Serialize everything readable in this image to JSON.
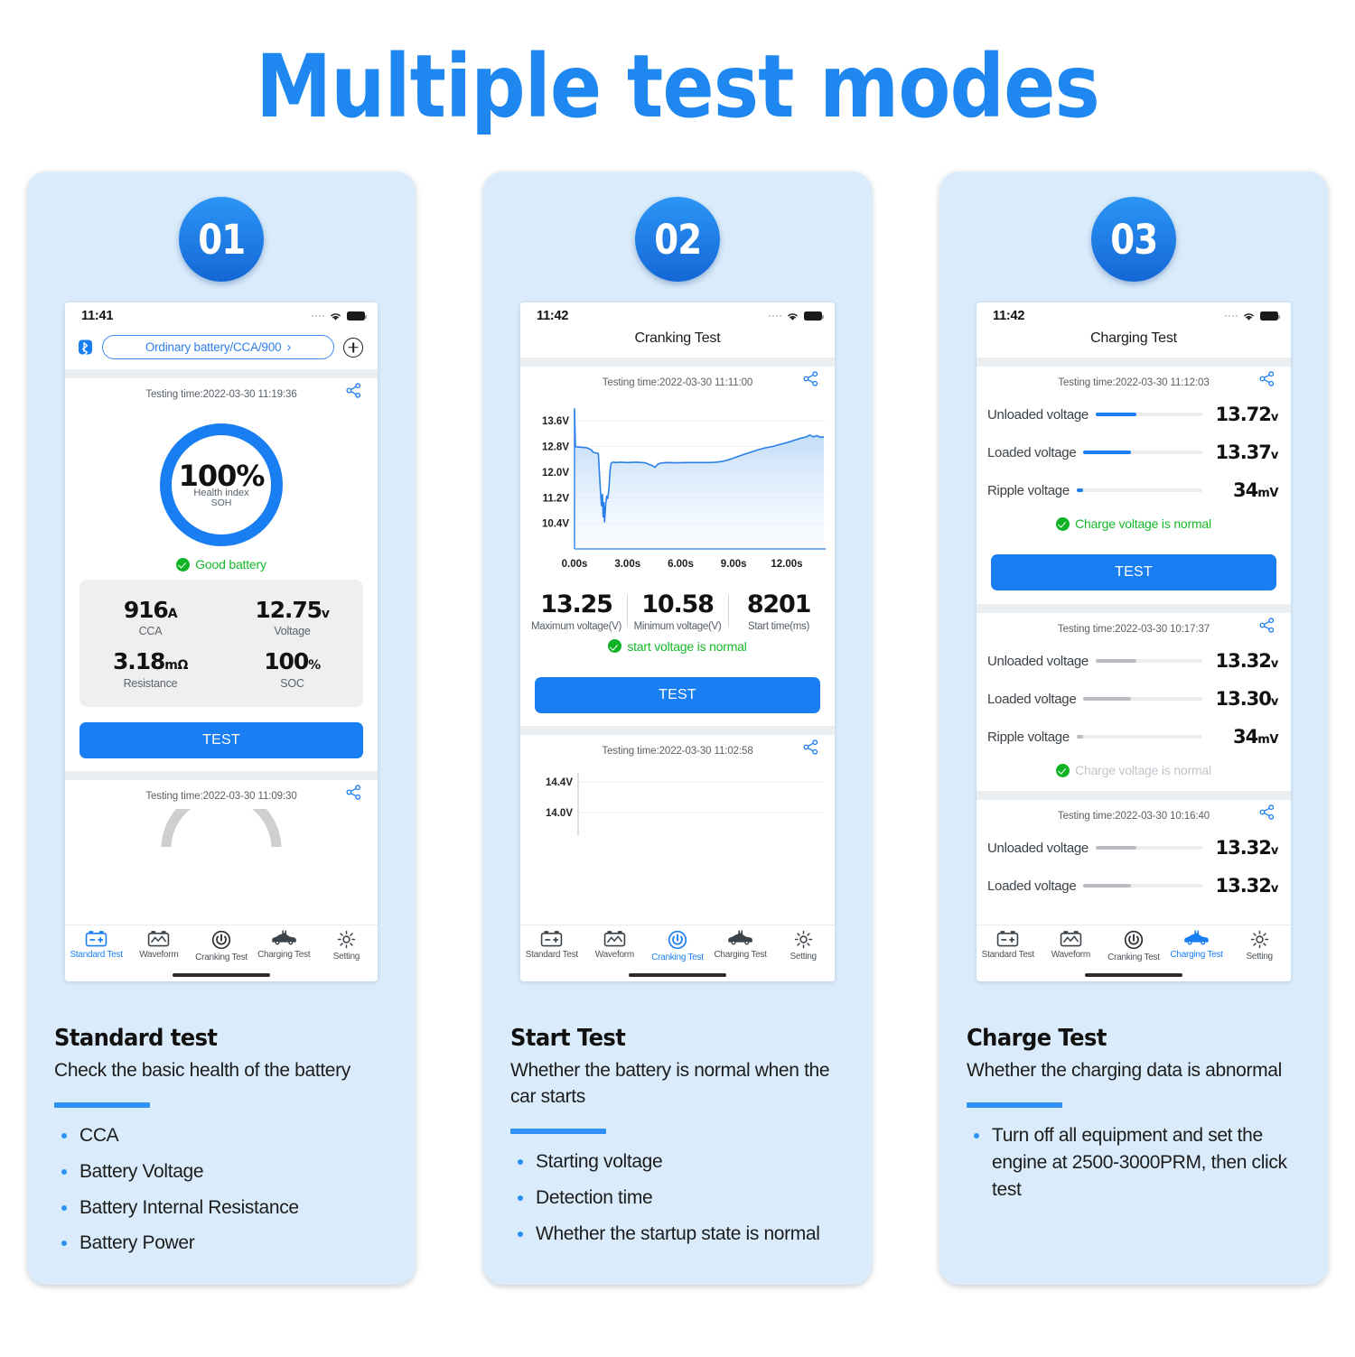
{
  "title": "Multiple test modes",
  "colors": {
    "accent": "#1a7ef3",
    "card_bg": "#daecfb",
    "ok_green": "#14b828",
    "title_blue": "#1e87f0"
  },
  "tabbar": {
    "items": [
      {
        "label": "Standard Test",
        "icon": "battery-terminals-icon"
      },
      {
        "label": "Waveform",
        "icon": "waveform-battery-icon"
      },
      {
        "label": "Cranking Test",
        "icon": "power-button-icon"
      },
      {
        "label": "Charging Test",
        "icon": "car-plug-icon"
      },
      {
        "label": "Setting",
        "icon": "gear-icon"
      }
    ]
  },
  "cards": [
    {
      "badge": "01",
      "caption": {
        "title": "Standard test",
        "subtitle": "Check the basic health of the battery",
        "bullets": [
          "CCA",
          "Battery Voltage",
          "Battery Internal Resistance",
          "Battery Power"
        ]
      },
      "phone": {
        "status": {
          "time": "11:41"
        },
        "selector": {
          "bluetooth": "bluetooth-icon",
          "label": "Ordinary battery/CCA/900",
          "chevron": "›",
          "add": "plus-icon"
        },
        "active_tab": 0,
        "section1": {
          "testing_time": "Testing time:2022-03-30 11:19:36",
          "soh": {
            "percent": "100%",
            "label1": "Health index",
            "label2": "SOH"
          },
          "status_text": "Good battery",
          "stats": [
            {
              "value": "916",
              "unit": "A",
              "label": "CCA"
            },
            {
              "value": "12.75",
              "unit": "v",
              "label": "Voltage"
            },
            {
              "value": "3.18",
              "unit": "mΩ",
              "label": "Resistance"
            },
            {
              "value": "100",
              "unit": "%",
              "label": "SOC"
            }
          ],
          "button": "TEST"
        },
        "section2": {
          "testing_time": "Testing time:2022-03-30 11:09:30"
        }
      }
    },
    {
      "badge": "02",
      "caption": {
        "title": "Start Test",
        "subtitle": "Whether the battery is normal when the car starts",
        "bullets": [
          "Starting voltage",
          "Detection time",
          "Whether the startup state is normal"
        ]
      },
      "phone": {
        "status": {
          "time": "11:42"
        },
        "header": "Cranking Test",
        "active_tab": 2,
        "section1": {
          "testing_time": "Testing time:2022-03-30 11:11:00",
          "stats": [
            {
              "value": "13.25",
              "label": "Maximum voltage(V)"
            },
            {
              "value": "10.58",
              "label": "Minimum voltage(V)"
            },
            {
              "value": "8201",
              "label": "Start time(ms)"
            }
          ],
          "status_text": "start voltage is normal",
          "button": "TEST"
        },
        "section2": {
          "testing_time": "Testing time:2022-03-30 11:02:58"
        }
      }
    },
    {
      "badge": "03",
      "caption": {
        "title": "Charge Test",
        "subtitle": "Whether the charging data is abnormal",
        "bullets": [
          "Turn off all equipment and set the engine at 2500-3000PRM, then click test"
        ]
      },
      "phone": {
        "status": {
          "time": "11:42"
        },
        "header": "Charging Test",
        "active_tab": 3,
        "sections": [
          {
            "testing_time": "Testing time:2022-03-30 11:12:03",
            "rows": [
              {
                "label": "Unloaded voltage",
                "value": "13.72",
                "unit": "v",
                "fill": 38,
                "active": true
              },
              {
                "label": "Loaded voltage",
                "value": "13.37",
                "unit": "v",
                "fill": 40,
                "active": true
              },
              {
                "label": "Ripple   voltage",
                "value": "34",
                "unit": "mV",
                "fill": 5,
                "active": true
              }
            ],
            "status_text": "Charge voltage is normal",
            "status_dim": false,
            "button": "TEST"
          },
          {
            "testing_time": "Testing time:2022-03-30 10:17:37",
            "rows": [
              {
                "label": "Unloaded voltage",
                "value": "13.32",
                "unit": "v",
                "fill": 38,
                "active": false
              },
              {
                "label": "Loaded voltage",
                "value": "13.30",
                "unit": "v",
                "fill": 40,
                "active": false
              },
              {
                "label": "Ripple   voltage",
                "value": "34",
                "unit": "mV",
                "fill": 5,
                "active": false
              }
            ],
            "status_text": "Charge voltage is normal",
            "status_dim": true
          },
          {
            "testing_time": "Testing time:2022-03-30 10:16:40",
            "rows": [
              {
                "label": "Unloaded voltage",
                "value": "13.32",
                "unit": "v",
                "fill": 38,
                "active": false
              },
              {
                "label": "Loaded voltage",
                "value": "13.32",
                "unit": "v",
                "fill": 40,
                "active": false
              }
            ]
          }
        ]
      }
    }
  ],
  "chart_data": [
    {
      "type": "area",
      "title": "Cranking voltage waveform",
      "xlabel": "",
      "ylabel": "",
      "ytick_labels": [
        "13.6V",
        "12.8V",
        "12.0V",
        "11.2V",
        "10.4V"
      ],
      "ytick_values": [
        13.6,
        12.8,
        12.0,
        11.2,
        10.4
      ],
      "xtick_labels": [
        "0.00s",
        "3.00s",
        "6.00s",
        "9.00s",
        "12.00s"
      ],
      "xtick_values": [
        0,
        3,
        6,
        9,
        12
      ],
      "xlim": [
        0,
        14.2
      ],
      "ylim": [
        9.6,
        14.0
      ],
      "grid": true,
      "legend": "none",
      "line_color": "#2b7fe8",
      "series": [
        {
          "name": "Voltage",
          "x": [
            0.0,
            0.05,
            0.1,
            0.4,
            0.7,
            0.95,
            1.05,
            1.2,
            1.35,
            1.45,
            1.52,
            1.58,
            1.62,
            1.66,
            1.7,
            1.76,
            1.82,
            1.88,
            1.94,
            2.0,
            2.06,
            2.12,
            2.2,
            2.35,
            2.6,
            3.0,
            3.5,
            4.0,
            4.4,
            4.55,
            4.7,
            4.85,
            5.2,
            5.8,
            6.4,
            7.0,
            7.6,
            8.0,
            8.4,
            8.8,
            9.2,
            9.6,
            10.0,
            10.4,
            10.8,
            11.2,
            11.6,
            12.0,
            12.4,
            12.8,
            13.1,
            13.3,
            13.5,
            13.7,
            13.9,
            14.1
          ],
          "y": [
            13.95,
            12.8,
            12.79,
            12.78,
            12.76,
            12.7,
            12.62,
            12.6,
            12.58,
            11.55,
            10.95,
            11.3,
            10.6,
            11.05,
            10.45,
            11.0,
            11.25,
            11.18,
            11.45,
            12.0,
            12.26,
            12.3,
            12.31,
            12.3,
            12.31,
            12.3,
            12.31,
            12.29,
            12.2,
            12.15,
            12.24,
            12.28,
            12.3,
            12.29,
            12.3,
            12.3,
            12.3,
            12.31,
            12.34,
            12.4,
            12.48,
            12.56,
            12.63,
            12.7,
            12.76,
            12.8,
            12.86,
            12.92,
            12.99,
            13.06,
            13.1,
            13.16,
            13.1,
            13.14,
            13.09,
            13.1
          ]
        }
      ]
    },
    {
      "type": "line",
      "title": "",
      "ytick_labels": [
        "14.4V",
        "14.0V"
      ],
      "ytick_values": [
        14.4,
        14.0
      ],
      "xtick_labels": [],
      "grid": true,
      "series": [
        {
          "name": "Voltage",
          "x": [],
          "y": []
        }
      ]
    }
  ]
}
